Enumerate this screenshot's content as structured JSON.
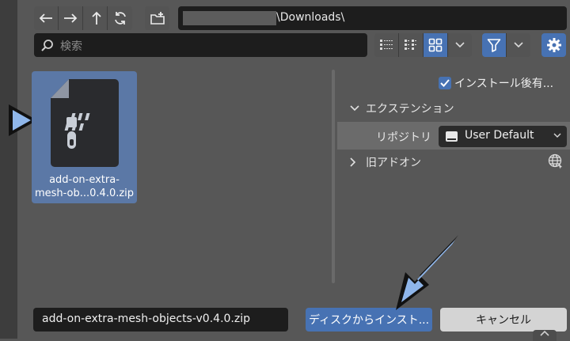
{
  "nav": {
    "back_icon": "back-arrow-icon",
    "forward_icon": "forward-arrow-icon",
    "parent_icon": "parent-directory-icon",
    "refresh_icon": "refresh-icon",
    "new_folder_icon": "new-folder-icon"
  },
  "path": {
    "value": "\\Downloads\\"
  },
  "search": {
    "placeholder": "検索"
  },
  "file": {
    "name_line1": "add-on-extra-",
    "name_line2": "mesh-ob...0.4.0.zip"
  },
  "options": {
    "enable_after_install_label": "インストール後有...",
    "enable_after_install_checked": true,
    "extension_section": "エクステンション",
    "repository_label": "リポジトリ",
    "repository_value": "User Default",
    "legacy_section": "旧アドオン"
  },
  "footer": {
    "filename_value": "add-on-extra-mesh-objects-v0.4.0.zip",
    "install_label": "ディスクからインスト...",
    "cancel_label": "キャンセル"
  },
  "colors": {
    "accent": "#4772b3",
    "panel": "#575757",
    "field": "#1d1d1d",
    "selected_tile": "#5b78a6"
  }
}
